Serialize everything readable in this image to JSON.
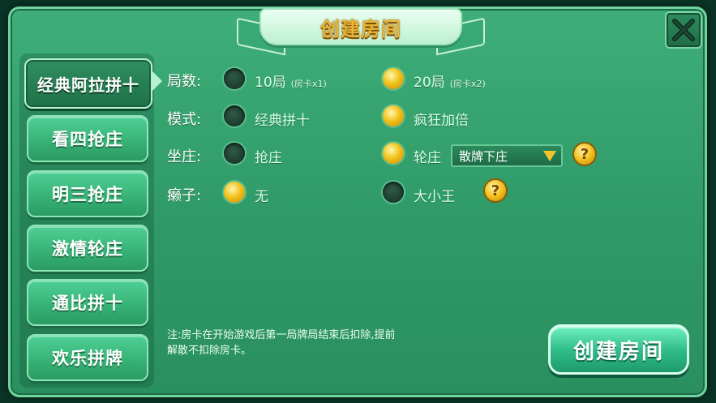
{
  "dialog": {
    "title": "创建房间",
    "close_glyph": "X",
    "accent_color": "#3fae79",
    "highlight_color": "#f2c21b"
  },
  "tabs": [
    {
      "label": "经典阿拉拼十",
      "active": true
    },
    {
      "label": "看四抢庄",
      "active": false
    },
    {
      "label": "明三抢庄",
      "active": false
    },
    {
      "label": "激情轮庄",
      "active": false
    },
    {
      "label": "通比拼十",
      "active": false
    },
    {
      "label": "欢乐拼牌",
      "active": false
    }
  ],
  "options": {
    "rounds": {
      "label": "局数:",
      "choices": [
        {
          "text": "10局",
          "sub": "(房卡x1)",
          "selected": false
        },
        {
          "text": "20局",
          "sub": "(房卡x2)",
          "selected": true
        }
      ]
    },
    "mode": {
      "label": "模式:",
      "choices": [
        {
          "text": "经典拼十",
          "selected": false
        },
        {
          "text": "疯狂加倍",
          "selected": true
        }
      ]
    },
    "banker": {
      "label": "坐庄:",
      "choices": [
        {
          "text": "抢庄",
          "selected": false
        },
        {
          "text": "轮庄",
          "selected": true
        }
      ],
      "select_value": "散牌下庄"
    },
    "wild": {
      "label": "癞子:",
      "choices": [
        {
          "text": "无",
          "selected": true
        },
        {
          "text": "大小王",
          "selected": false
        }
      ]
    }
  },
  "help_glyph": "?",
  "note": "注:房卡在开始游戏后第一局牌局结束后扣除,提前解散不扣除房卡。",
  "create_button": "创建房间"
}
